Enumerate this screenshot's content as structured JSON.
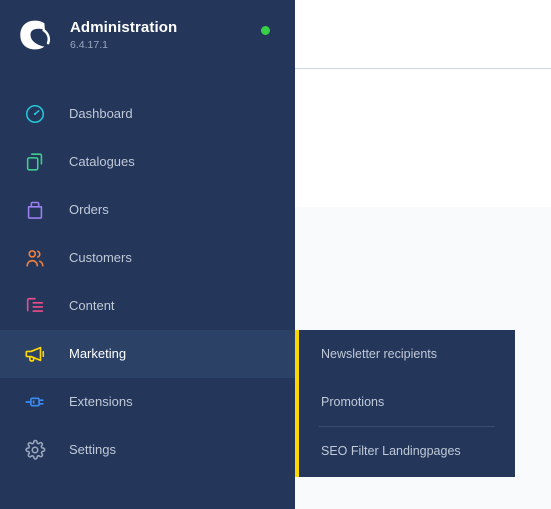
{
  "brand": {
    "logo_icon": "shopware-logo-icon",
    "title": "Administration",
    "version": "6.4.17.1",
    "status_dot_color": "#37d046",
    "status_dot_icon": "status-online-dot"
  },
  "colors": {
    "sidebar_bg": "#24375a",
    "sidebar_active_bg": "#2c4166",
    "flyout_accent": "#ffd700",
    "content_bg": "#f9fafb",
    "header_bg": "#ffffff",
    "header_border": "#d1d9e0",
    "label": "#bfc9d8",
    "label_active": "#ffffff"
  },
  "sidebar": {
    "items": [
      {
        "label": "Dashboard",
        "icon": "gauge-icon",
        "color": "#26c6da",
        "active": false
      },
      {
        "label": "Catalogues",
        "icon": "layers-icon",
        "color": "#3ecf8e",
        "active": false
      },
      {
        "label": "Orders",
        "icon": "bag-icon",
        "color": "#9b7ff0",
        "active": false
      },
      {
        "label": "Customers",
        "icon": "users-icon",
        "color": "#f5813c",
        "active": false
      },
      {
        "label": "Content",
        "icon": "content-icon",
        "color": "#ef4c8b",
        "active": false
      },
      {
        "label": "Marketing",
        "icon": "megaphone-icon",
        "color": "#ffd700",
        "active": true
      },
      {
        "label": "Extensions",
        "icon": "plug-icon",
        "color": "#3a8bf5",
        "active": false
      },
      {
        "label": "Settings",
        "icon": "gear-icon",
        "color": "#9aa7bd",
        "active": false
      }
    ]
  },
  "flyout": {
    "parent": "Marketing",
    "items": [
      {
        "label": "Newsletter recipients",
        "divider_after": false
      },
      {
        "label": "Promotions",
        "divider_after": true
      },
      {
        "label": "SEO Filter Landingpages",
        "divider_after": false
      }
    ]
  }
}
